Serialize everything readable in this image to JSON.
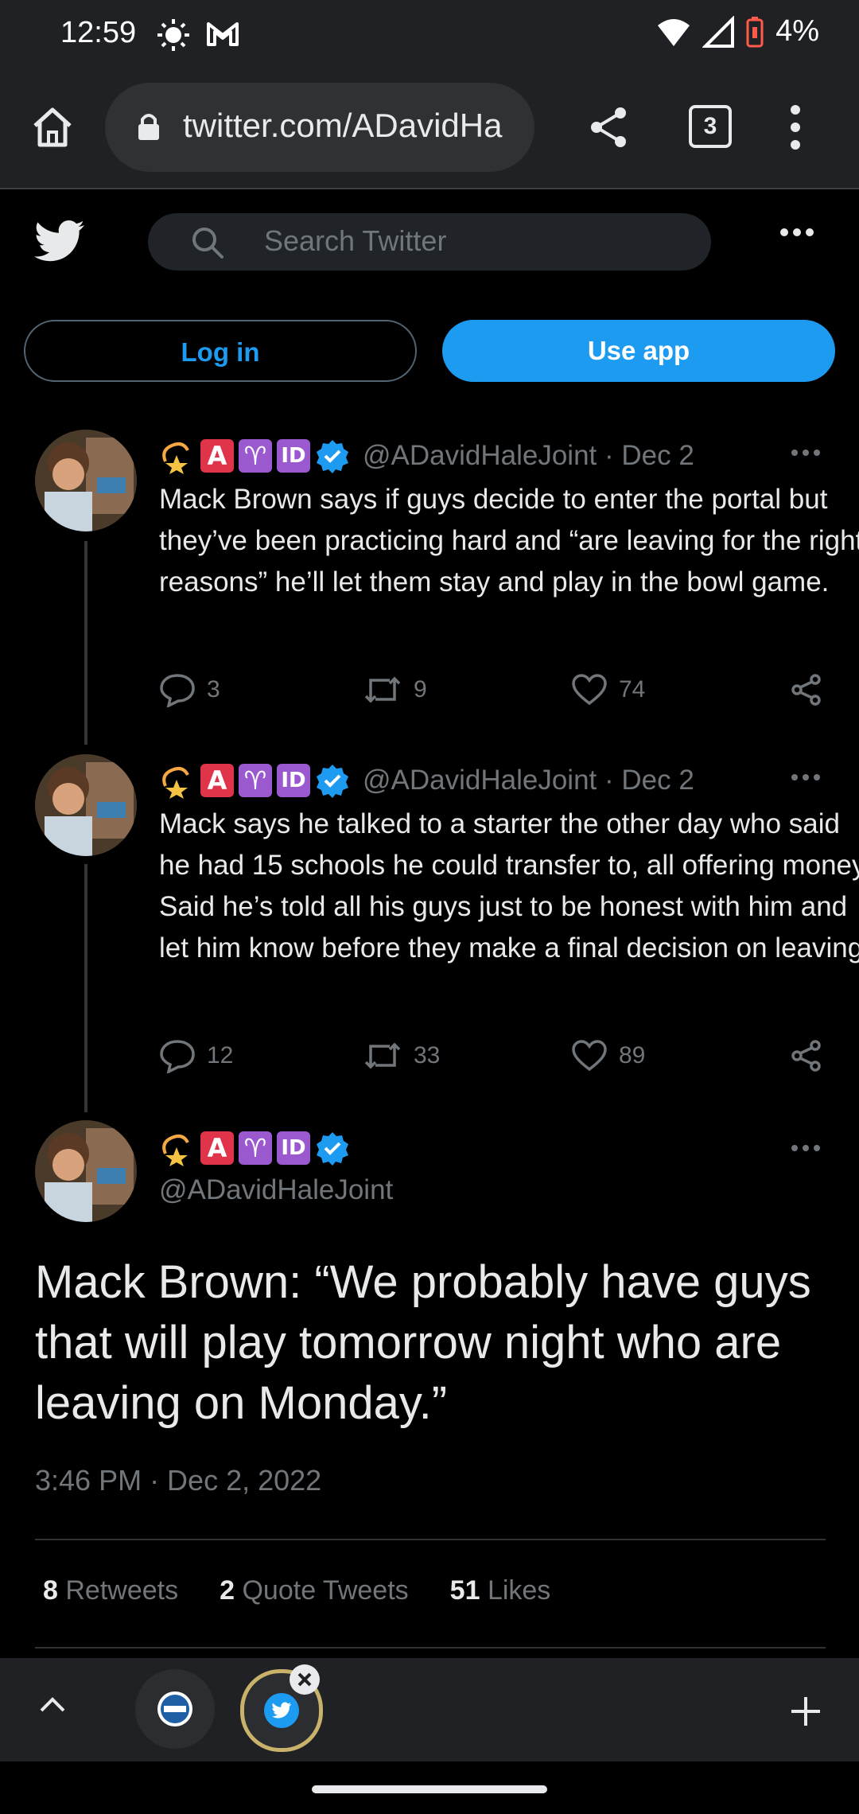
{
  "status_bar": {
    "time": "12:59",
    "battery": "4%"
  },
  "browser": {
    "url": "twitter.com/ADavidHa",
    "tab_count": "3"
  },
  "header": {
    "search_placeholder": "Search Twitter"
  },
  "auth": {
    "login_label": "Log in",
    "use_app_label": "Use app"
  },
  "badges": [
    "A",
    "♈",
    "ID"
  ],
  "tweets": [
    {
      "handle": "@ADavidHaleJoint · Dec 2",
      "text": "Mack Brown says if guys decide to enter the portal but they’ve been practicing hard and “are leaving for the right reasons” he’ll let them stay and play in the bowl game.",
      "replies": "3",
      "retweets": "9",
      "likes": "74"
    },
    {
      "handle": "@ADavidHaleJoint · Dec 2",
      "text": "Mack says he talked to a starter the other day who said he had 15 schools he could transfer to, all offering money. Said he’s told all his guys just to be honest with him and let him know before they make a final decision on leaving.",
      "replies": "12",
      "retweets": "33",
      "likes": "89"
    }
  ],
  "main_tweet": {
    "handle": "@ADavidHaleJoint",
    "text": "Mack Brown: “We probably have guys that will play tomorrow night who are leaving on Monday.”",
    "timestamp": "3:46 PM · Dec 2, 2022",
    "stats": [
      {
        "num": "8",
        "label": "Retweets"
      },
      {
        "num": "2",
        "label": "Quote Tweets"
      },
      {
        "num": "51",
        "label": "Likes"
      }
    ]
  },
  "colors": {
    "accent": "#1d9bf0",
    "background": "#000000",
    "chrome": "#202124",
    "muted": "#71767b",
    "badge_red": "#e0344a",
    "badge_purple": "#9b59d0",
    "verified": "#1d9bf0"
  }
}
